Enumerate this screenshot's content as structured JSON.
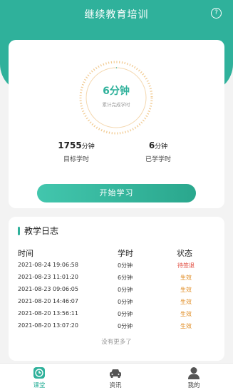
{
  "header": {
    "title": "继续教育培训",
    "help_icon": "help-circle-icon"
  },
  "progress": {
    "value": "6分钟",
    "label": "累计完成学时",
    "fraction": 0.0034
  },
  "stats": {
    "target_value": "1755",
    "target_unit": "分钟",
    "target_label": "目标学时",
    "done_value": "6",
    "done_unit": "分钟",
    "done_label": "已学学时"
  },
  "start_button": "开始学习",
  "log": {
    "title": "教学日志",
    "headers": {
      "time": "时间",
      "hours": "学时",
      "status": "状态"
    },
    "rows": [
      {
        "time": "2021-08-24 19:06:58",
        "hours": "0分钟",
        "status": "待签退",
        "status_color": "#e0483b"
      },
      {
        "time": "2021-08-23 11:01:20",
        "hours": "6分钟",
        "status": "生效",
        "status_color": "#e08a1e"
      },
      {
        "time": "2021-08-23 09:06:05",
        "hours": "0分钟",
        "status": "生效",
        "status_color": "#e08a1e"
      },
      {
        "time": "2021-08-20 14:46:07",
        "hours": "0分钟",
        "status": "生效",
        "status_color": "#e08a1e"
      },
      {
        "time": "2021-08-20 13:56:11",
        "hours": "0分钟",
        "status": "生效",
        "status_color": "#e08a1e"
      },
      {
        "time": "2021-08-20 13:07:20",
        "hours": "0分钟",
        "status": "生效",
        "status_color": "#e08a1e"
      }
    ],
    "no_more": "没有更多了"
  },
  "tabbar": {
    "items": [
      {
        "label": "课堂",
        "icon": "clock-icon",
        "active": true
      },
      {
        "label": "资讯",
        "icon": "car-icon",
        "active": false
      },
      {
        "label": "我的",
        "icon": "user-icon",
        "active": false
      }
    ]
  },
  "colors": {
    "accent": "#2fb19b",
    "ring_track": "#f1c98f",
    "pending": "#e0483b",
    "active_status": "#e08a1e"
  }
}
